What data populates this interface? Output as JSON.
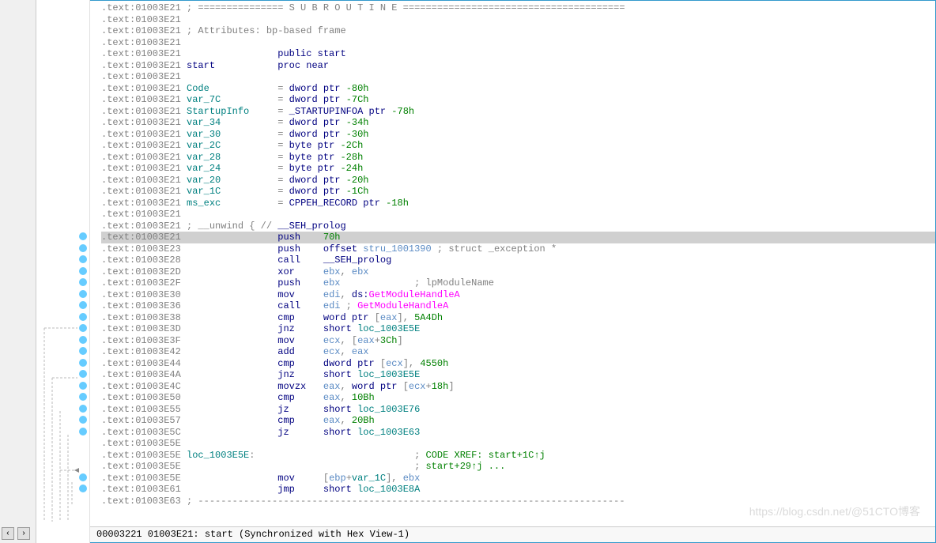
{
  "lines": [
    {
      "addr": ".text:01003E21",
      "body": "; =============== S U B R O U T I N E =======================================",
      "cls": "comment"
    },
    {
      "addr": ".text:01003E21",
      "body": ""
    },
    {
      "addr": ".text:01003E21",
      "body": "; Attributes: bp-based frame",
      "cls": "comment"
    },
    {
      "addr": ".text:01003E21",
      "body": ""
    },
    {
      "addr": ".text:01003E21",
      "body": "                public start",
      "parts": [
        {
          "t": "                ",
          "c": ""
        },
        {
          "t": "public start",
          "c": "keyword"
        }
      ]
    },
    {
      "addr": ".text:01003E21",
      "body": "start           proc near",
      "parts": [
        {
          "t": "start",
          "c": "keyword"
        },
        {
          "t": "           ",
          "c": ""
        },
        {
          "t": "proc near",
          "c": "keyword"
        }
      ]
    },
    {
      "addr": ".text:01003E21",
      "body": ""
    },
    {
      "addr": ".text:01003E21",
      "parts": [
        {
          "t": "Code",
          "c": "label"
        },
        {
          "t": "            = ",
          "c": ""
        },
        {
          "t": "dword ptr ",
          "c": "keyword"
        },
        {
          "t": "-80h",
          "c": "number"
        }
      ]
    },
    {
      "addr": ".text:01003E21",
      "parts": [
        {
          "t": "var_7C",
          "c": "label"
        },
        {
          "t": "          = ",
          "c": ""
        },
        {
          "t": "dword ptr ",
          "c": "keyword"
        },
        {
          "t": "-7Ch",
          "c": "number"
        }
      ]
    },
    {
      "addr": ".text:01003E21",
      "parts": [
        {
          "t": "StartupInfo",
          "c": "label"
        },
        {
          "t": "     = ",
          "c": ""
        },
        {
          "t": "_STARTUPINFOA ptr ",
          "c": "keyword"
        },
        {
          "t": "-78h",
          "c": "number"
        }
      ]
    },
    {
      "addr": ".text:01003E21",
      "parts": [
        {
          "t": "var_34",
          "c": "label"
        },
        {
          "t": "          = ",
          "c": ""
        },
        {
          "t": "dword ptr ",
          "c": "keyword"
        },
        {
          "t": "-34h",
          "c": "number"
        }
      ]
    },
    {
      "addr": ".text:01003E21",
      "parts": [
        {
          "t": "var_30",
          "c": "label"
        },
        {
          "t": "          = ",
          "c": ""
        },
        {
          "t": "dword ptr ",
          "c": "keyword"
        },
        {
          "t": "-30h",
          "c": "number"
        }
      ]
    },
    {
      "addr": ".text:01003E21",
      "parts": [
        {
          "t": "var_2C",
          "c": "label"
        },
        {
          "t": "          = ",
          "c": ""
        },
        {
          "t": "byte ptr ",
          "c": "keyword"
        },
        {
          "t": "-2Ch",
          "c": "number"
        }
      ]
    },
    {
      "addr": ".text:01003E21",
      "parts": [
        {
          "t": "var_28",
          "c": "label"
        },
        {
          "t": "          = ",
          "c": ""
        },
        {
          "t": "byte ptr ",
          "c": "keyword"
        },
        {
          "t": "-28h",
          "c": "number"
        }
      ]
    },
    {
      "addr": ".text:01003E21",
      "parts": [
        {
          "t": "var_24",
          "c": "label"
        },
        {
          "t": "          = ",
          "c": ""
        },
        {
          "t": "byte ptr ",
          "c": "keyword"
        },
        {
          "t": "-24h",
          "c": "number"
        }
      ]
    },
    {
      "addr": ".text:01003E21",
      "parts": [
        {
          "t": "var_20",
          "c": "label"
        },
        {
          "t": "          = ",
          "c": ""
        },
        {
          "t": "dword ptr ",
          "c": "keyword"
        },
        {
          "t": "-20h",
          "c": "number"
        }
      ]
    },
    {
      "addr": ".text:01003E21",
      "parts": [
        {
          "t": "var_1C",
          "c": "label"
        },
        {
          "t": "          = ",
          "c": ""
        },
        {
          "t": "dword ptr ",
          "c": "keyword"
        },
        {
          "t": "-1Ch",
          "c": "number"
        }
      ]
    },
    {
      "addr": ".text:01003E21",
      "parts": [
        {
          "t": "ms_exc",
          "c": "label"
        },
        {
          "t": "          = ",
          "c": ""
        },
        {
          "t": "CPPEH_RECORD ptr ",
          "c": "keyword"
        },
        {
          "t": "-18h",
          "c": "number"
        }
      ]
    },
    {
      "addr": ".text:01003E21",
      "body": ""
    },
    {
      "addr": ".text:01003E21",
      "parts": [
        {
          "t": "; __unwind { // ",
          "c": "comment"
        },
        {
          "t": "__SEH_prolog",
          "c": "keyword"
        }
      ]
    },
    {
      "addr": ".text:01003E21",
      "highlighted": true,
      "bp": true,
      "parts": [
        {
          "t": "                ",
          "c": ""
        },
        {
          "t": "push",
          "c": "mnemonic"
        },
        {
          "t": "    ",
          "c": ""
        },
        {
          "t": "70h",
          "c": "number"
        }
      ]
    },
    {
      "addr": ".text:01003E23",
      "bp": true,
      "parts": [
        {
          "t": "                ",
          "c": ""
        },
        {
          "t": "push",
          "c": "mnemonic"
        },
        {
          "t": "    ",
          "c": ""
        },
        {
          "t": "offset",
          "c": "keyword"
        },
        {
          "t": " ",
          "c": ""
        },
        {
          "t": "stru_1001390",
          "c": "name"
        },
        {
          "t": " ; ",
          "c": "comment"
        },
        {
          "t": "struct _exception *",
          "c": "comment"
        }
      ]
    },
    {
      "addr": ".text:01003E28",
      "bp": true,
      "parts": [
        {
          "t": "                ",
          "c": ""
        },
        {
          "t": "call",
          "c": "mnemonic"
        },
        {
          "t": "    ",
          "c": ""
        },
        {
          "t": "__SEH_prolog",
          "c": "keyword"
        }
      ]
    },
    {
      "addr": ".text:01003E2D",
      "bp": true,
      "parts": [
        {
          "t": "                ",
          "c": ""
        },
        {
          "t": "xor",
          "c": "mnemonic"
        },
        {
          "t": "     ",
          "c": ""
        },
        {
          "t": "ebx",
          "c": "reg"
        },
        {
          "t": ", ",
          "c": ""
        },
        {
          "t": "ebx",
          "c": "reg"
        }
      ]
    },
    {
      "addr": ".text:01003E2F",
      "bp": true,
      "parts": [
        {
          "t": "                ",
          "c": ""
        },
        {
          "t": "push",
          "c": "mnemonic"
        },
        {
          "t": "    ",
          "c": ""
        },
        {
          "t": "ebx",
          "c": "reg"
        },
        {
          "t": "             ; ",
          "c": "comment"
        },
        {
          "t": "lpModuleName",
          "c": "comment"
        }
      ]
    },
    {
      "addr": ".text:01003E30",
      "bp": true,
      "parts": [
        {
          "t": "                ",
          "c": ""
        },
        {
          "t": "mov",
          "c": "mnemonic"
        },
        {
          "t": "     ",
          "c": ""
        },
        {
          "t": "edi",
          "c": "reg"
        },
        {
          "t": ", ",
          "c": ""
        },
        {
          "t": "ds:",
          "c": "keyword"
        },
        {
          "t": "GetModuleHandleA",
          "c": "func"
        }
      ]
    },
    {
      "addr": ".text:01003E36",
      "bp": true,
      "parts": [
        {
          "t": "                ",
          "c": ""
        },
        {
          "t": "call",
          "c": "mnemonic"
        },
        {
          "t": "    ",
          "c": ""
        },
        {
          "t": "edi",
          "c": "reg"
        },
        {
          "t": " ; ",
          "c": "comment"
        },
        {
          "t": "GetModuleHandleA",
          "c": "func"
        }
      ]
    },
    {
      "addr": ".text:01003E38",
      "bp": true,
      "parts": [
        {
          "t": "                ",
          "c": ""
        },
        {
          "t": "cmp",
          "c": "mnemonic"
        },
        {
          "t": "     ",
          "c": ""
        },
        {
          "t": "word ptr ",
          "c": "keyword"
        },
        {
          "t": "[",
          "c": ""
        },
        {
          "t": "eax",
          "c": "reg"
        },
        {
          "t": "], ",
          "c": ""
        },
        {
          "t": "5A4Dh",
          "c": "number"
        }
      ]
    },
    {
      "addr": ".text:01003E3D",
      "bp": true,
      "parts": [
        {
          "t": "                ",
          "c": ""
        },
        {
          "t": "jnz",
          "c": "mnemonic"
        },
        {
          "t": "     ",
          "c": ""
        },
        {
          "t": "short ",
          "c": "keyword"
        },
        {
          "t": "loc_1003E5E",
          "c": "label"
        }
      ]
    },
    {
      "addr": ".text:01003E3F",
      "bp": true,
      "parts": [
        {
          "t": "                ",
          "c": ""
        },
        {
          "t": "mov",
          "c": "mnemonic"
        },
        {
          "t": "     ",
          "c": ""
        },
        {
          "t": "ecx",
          "c": "reg"
        },
        {
          "t": ", [",
          "c": ""
        },
        {
          "t": "eax",
          "c": "reg"
        },
        {
          "t": "+",
          "c": ""
        },
        {
          "t": "3Ch",
          "c": "number"
        },
        {
          "t": "]",
          "c": ""
        }
      ]
    },
    {
      "addr": ".text:01003E42",
      "bp": true,
      "parts": [
        {
          "t": "                ",
          "c": ""
        },
        {
          "t": "add",
          "c": "mnemonic"
        },
        {
          "t": "     ",
          "c": ""
        },
        {
          "t": "ecx",
          "c": "reg"
        },
        {
          "t": ", ",
          "c": ""
        },
        {
          "t": "eax",
          "c": "reg"
        }
      ]
    },
    {
      "addr": ".text:01003E44",
      "bp": true,
      "parts": [
        {
          "t": "                ",
          "c": ""
        },
        {
          "t": "cmp",
          "c": "mnemonic"
        },
        {
          "t": "     ",
          "c": ""
        },
        {
          "t": "dword ptr ",
          "c": "keyword"
        },
        {
          "t": "[",
          "c": ""
        },
        {
          "t": "ecx",
          "c": "reg"
        },
        {
          "t": "], ",
          "c": ""
        },
        {
          "t": "4550h",
          "c": "number"
        }
      ]
    },
    {
      "addr": ".text:01003E4A",
      "bp": true,
      "parts": [
        {
          "t": "                ",
          "c": ""
        },
        {
          "t": "jnz",
          "c": "mnemonic"
        },
        {
          "t": "     ",
          "c": ""
        },
        {
          "t": "short ",
          "c": "keyword"
        },
        {
          "t": "loc_1003E5E",
          "c": "label"
        }
      ]
    },
    {
      "addr": ".text:01003E4C",
      "bp": true,
      "parts": [
        {
          "t": "                ",
          "c": ""
        },
        {
          "t": "movzx",
          "c": "mnemonic"
        },
        {
          "t": "   ",
          "c": ""
        },
        {
          "t": "eax",
          "c": "reg"
        },
        {
          "t": ", ",
          "c": ""
        },
        {
          "t": "word ptr ",
          "c": "keyword"
        },
        {
          "t": "[",
          "c": ""
        },
        {
          "t": "ecx",
          "c": "reg"
        },
        {
          "t": "+",
          "c": ""
        },
        {
          "t": "18h",
          "c": "number"
        },
        {
          "t": "]",
          "c": ""
        }
      ]
    },
    {
      "addr": ".text:01003E50",
      "bp": true,
      "parts": [
        {
          "t": "                ",
          "c": ""
        },
        {
          "t": "cmp",
          "c": "mnemonic"
        },
        {
          "t": "     ",
          "c": ""
        },
        {
          "t": "eax",
          "c": "reg"
        },
        {
          "t": ", ",
          "c": ""
        },
        {
          "t": "10Bh",
          "c": "number"
        }
      ]
    },
    {
      "addr": ".text:01003E55",
      "bp": true,
      "parts": [
        {
          "t": "                ",
          "c": ""
        },
        {
          "t": "jz",
          "c": "mnemonic"
        },
        {
          "t": "      ",
          "c": ""
        },
        {
          "t": "short ",
          "c": "keyword"
        },
        {
          "t": "loc_1003E76",
          "c": "label"
        }
      ]
    },
    {
      "addr": ".text:01003E57",
      "bp": true,
      "parts": [
        {
          "t": "                ",
          "c": ""
        },
        {
          "t": "cmp",
          "c": "mnemonic"
        },
        {
          "t": "     ",
          "c": ""
        },
        {
          "t": "eax",
          "c": "reg"
        },
        {
          "t": ", ",
          "c": ""
        },
        {
          "t": "20Bh",
          "c": "number"
        }
      ]
    },
    {
      "addr": ".text:01003E5C",
      "bp": true,
      "parts": [
        {
          "t": "                ",
          "c": ""
        },
        {
          "t": "jz",
          "c": "mnemonic"
        },
        {
          "t": "      ",
          "c": ""
        },
        {
          "t": "short ",
          "c": "keyword"
        },
        {
          "t": "loc_1003E63",
          "c": "label"
        }
      ]
    },
    {
      "addr": ".text:01003E5E",
      "body": ""
    },
    {
      "addr": ".text:01003E5E",
      "parts": [
        {
          "t": "loc_1003E5E",
          "c": "label"
        },
        {
          "t": ":",
          "c": ""
        },
        {
          "t": "                            ; ",
          "c": "comment"
        },
        {
          "t": "CODE XREF: start+1C↑j",
          "c": "xref"
        }
      ]
    },
    {
      "addr": ".text:01003E5E",
      "parts": [
        {
          "t": "                                        ; ",
          "c": "comment"
        },
        {
          "t": "start+29↑j ...",
          "c": "xref"
        }
      ]
    },
    {
      "addr": ".text:01003E5E",
      "bp": true,
      "parts": [
        {
          "t": "                ",
          "c": ""
        },
        {
          "t": "mov",
          "c": "mnemonic"
        },
        {
          "t": "     [",
          "c": ""
        },
        {
          "t": "ebp",
          "c": "reg"
        },
        {
          "t": "+",
          "c": ""
        },
        {
          "t": "var_1C",
          "c": "label"
        },
        {
          "t": "], ",
          "c": ""
        },
        {
          "t": "ebx",
          "c": "reg"
        }
      ]
    },
    {
      "addr": ".text:01003E61",
      "bp": true,
      "parts": [
        {
          "t": "                ",
          "c": ""
        },
        {
          "t": "jmp",
          "c": "mnemonic"
        },
        {
          "t": "     ",
          "c": ""
        },
        {
          "t": "short ",
          "c": "keyword"
        },
        {
          "t": "loc_1003E8A",
          "c": "label"
        }
      ]
    },
    {
      "addr": ".text:01003E63",
      "body": "; ---------------------------------------------------------------------------",
      "cls": "comment"
    }
  ],
  "statusbar": "00003221 01003E21: start (Synchronized with Hex View-1)",
  "watermark": "https://blog.csdn.net/@51CTO博客"
}
